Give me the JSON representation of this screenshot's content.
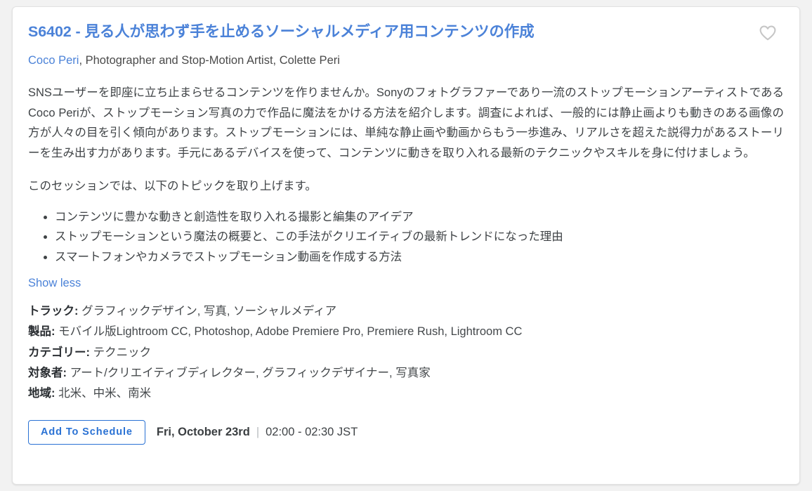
{
  "card": {
    "title": "S6402 - 見る人が思わず手を止めるソーシャルメディア用コンテンツの作成",
    "favorite_icon": "heart-outline-icon",
    "speakers": {
      "primary_name": "Coco Peri",
      "rest": ", Photographer and Stop-Motion Artist, Colette Peri"
    },
    "abstract": "SNSユーザーを即座に立ち止まらせるコンテンツを作りませんか。Sonyのフォトグラファーであり一流のストップモーションアーティストであるCoco Periが、ストップモーション写真の力で作品に魔法をかける方法を紹介します。調査によれば、一般的には静止画よりも動きのある画像の方が人々の目を引く傾向があります。ストップモーションには、単純な静止画や動画からもう一歩進み、リアルさを超えた説得力があるストーリーを生み出す力があります。手元にあるデバイスを使って、コンテンツに動きを取り入れる最新のテクニックやスキルを身に付けましょう。",
    "topics_lead_in": "このセッションでは、以下のトピックを取り上げます。",
    "topics": [
      "コンテンツに豊かな動きと創造性を取り入れる撮影と編集のアイデア",
      "ストップモーションという魔法の概要と、この手法がクリエイティブの最新トレンドになった理由",
      "スマートフォンやカメラでストップモーション動画を作成する方法"
    ],
    "show_less_label": "Show less",
    "meta": [
      {
        "label": "トラック:",
        "value": "グラフィックデザイン, 写真, ソーシャルメディア"
      },
      {
        "label": "製品:",
        "value": "モバイル版Lightroom CC, Photoshop, Adobe Premiere Pro, Premiere Rush, Lightroom CC"
      },
      {
        "label": "カテゴリー:",
        "value": "テクニック"
      },
      {
        "label": "対象者:",
        "value": "アート/クリエイティブディレクター, グラフィックデザイナー, 写真家"
      },
      {
        "label": "地域:",
        "value": "北米、中米、南米"
      }
    ],
    "add_to_schedule_label": "Add To Schedule",
    "schedule": {
      "date": "Fri, October 23rd",
      "separator": "|",
      "time": "02:00 - 02:30 JST"
    }
  },
  "colors": {
    "link_blue": "#4b82d8",
    "button_blue": "#2a72d4",
    "text": "#3f4346",
    "page_background": "#f2f2f2",
    "card_background": "#ffffff",
    "card_border": "#e2e2e2",
    "heart_grey": "#c6c6c6"
  }
}
